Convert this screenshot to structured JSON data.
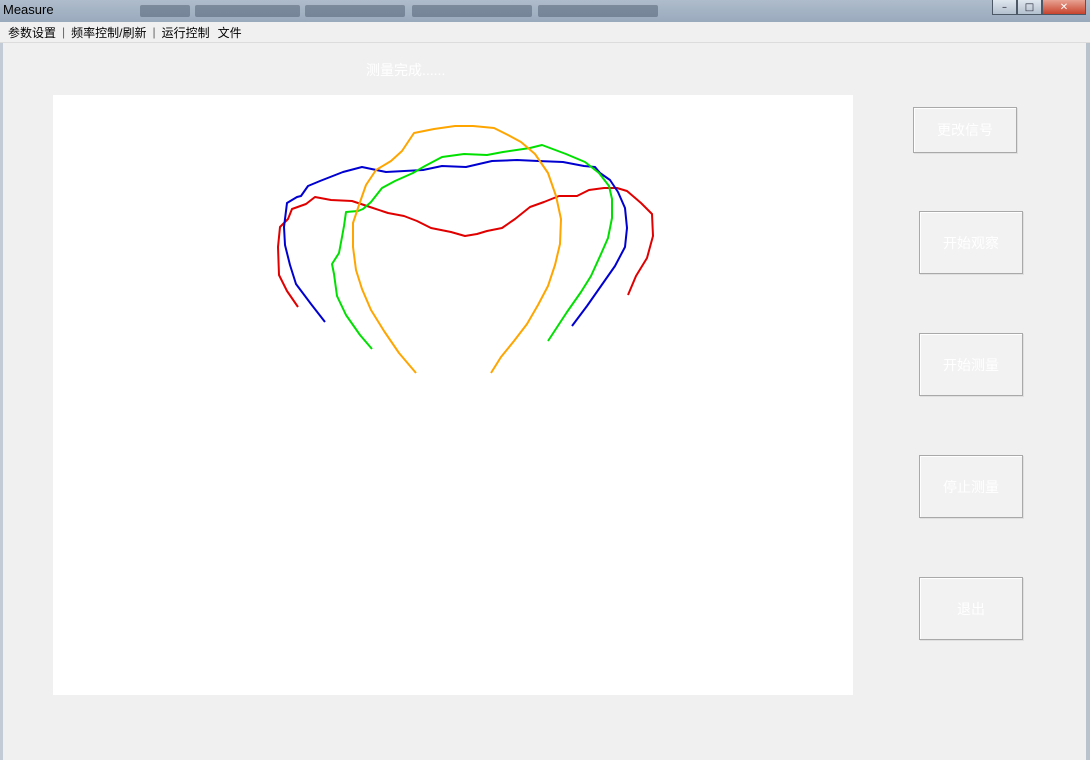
{
  "window": {
    "title": "Measure",
    "minimize_glyph": "–",
    "maximize_glyph": "□",
    "close_glyph": "✕"
  },
  "menu": {
    "items": [
      "参数设置",
      "频率控制/刷新",
      "运行控制",
      "文件"
    ],
    "separator": "|"
  },
  "status": {
    "text": "测量完成......"
  },
  "buttons": {
    "change_signal": "更改信号",
    "start_collect": "开始观察",
    "start_measure": "开始测量",
    "stop_measure": "停止测量",
    "exit": "退出"
  },
  "plot": {
    "curves": [
      {
        "color": "#e00000",
        "points": [
          [
            298,
            307
          ],
          [
            287,
            291
          ],
          [
            279,
            275
          ],
          [
            278,
            247
          ],
          [
            280,
            227
          ],
          [
            288,
            219
          ],
          [
            292,
            209
          ],
          [
            306,
            204
          ],
          [
            315,
            197
          ],
          [
            331,
            200
          ],
          [
            352,
            201
          ],
          [
            370,
            207
          ],
          [
            388,
            213
          ],
          [
            404,
            216
          ],
          [
            417,
            221
          ],
          [
            431,
            228
          ],
          [
            451,
            232
          ],
          [
            465,
            236
          ],
          [
            477,
            234
          ],
          [
            487,
            231
          ],
          [
            502,
            228
          ],
          [
            515,
            219
          ],
          [
            530,
            207
          ],
          [
            544,
            202
          ],
          [
            559,
            196
          ],
          [
            577,
            196
          ],
          [
            589,
            190
          ],
          [
            604,
            188
          ],
          [
            617,
            188
          ],
          [
            627,
            191
          ],
          [
            641,
            203
          ],
          [
            652,
            214
          ],
          [
            653,
            236
          ],
          [
            647,
            258
          ],
          [
            636,
            276
          ],
          [
            628,
            295
          ]
        ]
      },
      {
        "color": "#0000d0",
        "points": [
          [
            325,
            322
          ],
          [
            311,
            304
          ],
          [
            296,
            284
          ],
          [
            290,
            265
          ],
          [
            285,
            245
          ],
          [
            284,
            227
          ],
          [
            287,
            203
          ],
          [
            297,
            197
          ],
          [
            301,
            196
          ],
          [
            308,
            186
          ],
          [
            320,
            181
          ],
          [
            343,
            172
          ],
          [
            362,
            167
          ],
          [
            386,
            172
          ],
          [
            423,
            170
          ],
          [
            442,
            166
          ],
          [
            466,
            167
          ],
          [
            492,
            161
          ],
          [
            517,
            160
          ],
          [
            538,
            161
          ],
          [
            563,
            162
          ],
          [
            584,
            166
          ],
          [
            595,
            167
          ],
          [
            600,
            173
          ],
          [
            610,
            180
          ],
          [
            618,
            192
          ],
          [
            625,
            208
          ],
          [
            627,
            228
          ],
          [
            625,
            247
          ],
          [
            615,
            266
          ],
          [
            601,
            286
          ],
          [
            587,
            306
          ],
          [
            572,
            326
          ]
        ]
      },
      {
        "color": "#00e000",
        "points": [
          [
            372,
            349
          ],
          [
            360,
            335
          ],
          [
            346,
            315
          ],
          [
            337,
            296
          ],
          [
            334,
            274
          ],
          [
            332,
            264
          ],
          [
            339,
            253
          ],
          [
            342,
            237
          ],
          [
            344,
            226
          ],
          [
            346,
            212
          ],
          [
            358,
            211
          ],
          [
            363,
            209
          ],
          [
            371,
            202
          ],
          [
            382,
            188
          ],
          [
            395,
            181
          ],
          [
            413,
            173
          ],
          [
            425,
            166
          ],
          [
            442,
            157
          ],
          [
            464,
            154
          ],
          [
            487,
            155
          ],
          [
            503,
            152
          ],
          [
            530,
            148
          ],
          [
            542,
            145
          ],
          [
            566,
            154
          ],
          [
            585,
            162
          ],
          [
            599,
            173
          ],
          [
            609,
            186
          ],
          [
            612,
            199
          ],
          [
            612,
            218
          ],
          [
            608,
            238
          ],
          [
            601,
            254
          ],
          [
            591,
            276
          ],
          [
            581,
            292
          ],
          [
            567,
            312
          ],
          [
            548,
            341
          ]
        ]
      },
      {
        "color": "#ffa500",
        "points": [
          [
            416,
            373
          ],
          [
            399,
            353
          ],
          [
            384,
            331
          ],
          [
            371,
            310
          ],
          [
            362,
            289
          ],
          [
            356,
            270
          ],
          [
            353,
            247
          ],
          [
            353,
            223
          ],
          [
            359,
            205
          ],
          [
            366,
            185
          ],
          [
            376,
            170
          ],
          [
            391,
            161
          ],
          [
            402,
            151
          ],
          [
            414,
            133
          ],
          [
            434,
            129
          ],
          [
            455,
            126
          ],
          [
            473,
            126
          ],
          [
            494,
            128
          ],
          [
            508,
            135
          ],
          [
            521,
            142
          ],
          [
            535,
            154
          ],
          [
            548,
            173
          ],
          [
            556,
            196
          ],
          [
            561,
            219
          ],
          [
            560,
            244
          ],
          [
            555,
            265
          ],
          [
            548,
            286
          ],
          [
            538,
            305
          ],
          [
            527,
            324
          ],
          [
            514,
            341
          ],
          [
            501,
            357
          ],
          [
            491,
            373
          ]
        ]
      }
    ]
  }
}
